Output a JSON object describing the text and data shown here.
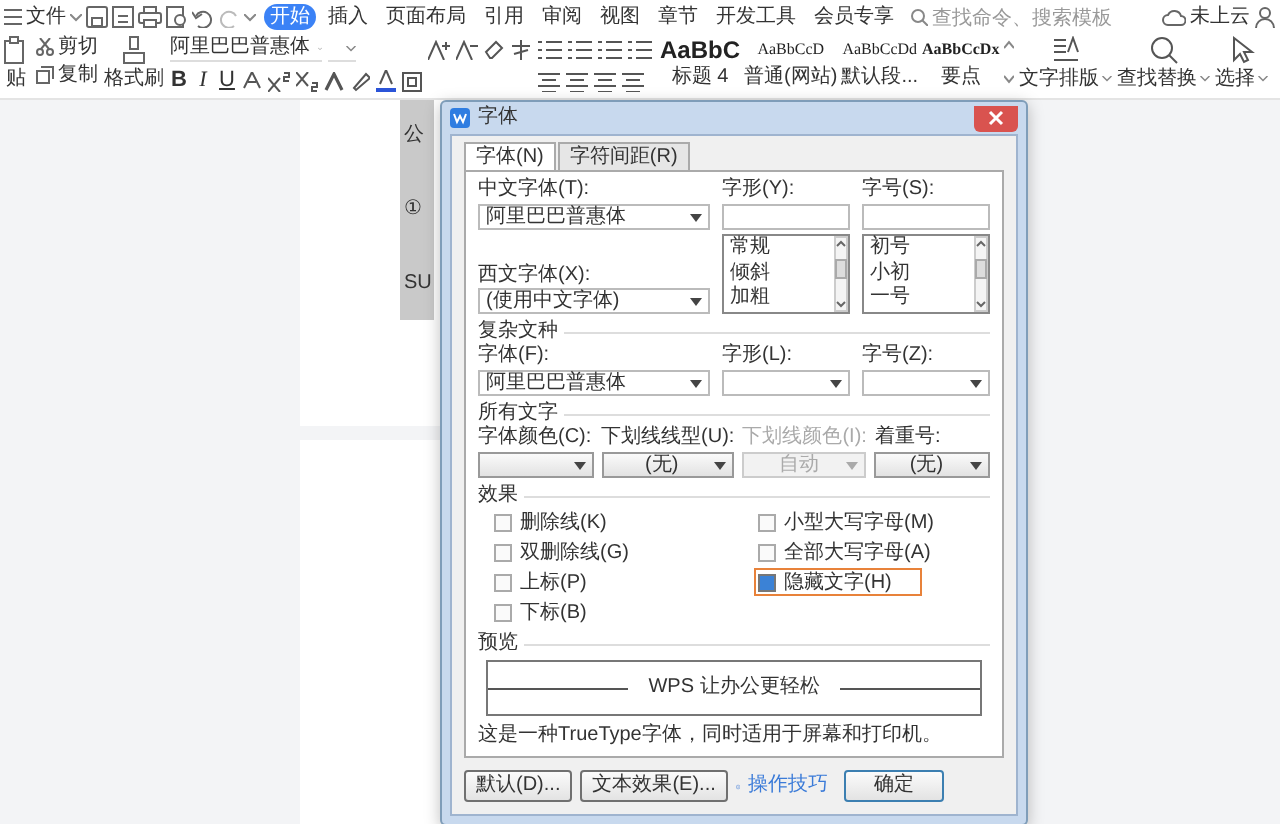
{
  "menu": {
    "file": "文件",
    "tabs": [
      {
        "label": "开始",
        "selected": true
      },
      {
        "label": "插入",
        "selected": false
      },
      {
        "label": "页面布局",
        "selected": false
      },
      {
        "label": "引用",
        "selected": false
      },
      {
        "label": "审阅",
        "selected": false
      },
      {
        "label": "视图",
        "selected": false
      },
      {
        "label": "章节",
        "selected": false
      },
      {
        "label": "开发工具",
        "selected": false
      },
      {
        "label": "会员专享",
        "selected": false
      }
    ],
    "search": {
      "placeholder": "查找命令、搜索模板"
    },
    "account": "未上云"
  },
  "ribbon": {
    "paste": "贴",
    "cut": "剪切",
    "copy": "复制",
    "format_painter": "格式刷",
    "font_name": "阿里巴巴普惠体",
    "text_buttons": [
      "B",
      "I",
      "U"
    ],
    "styles": [
      {
        "sample": "AaBbC",
        "label": "标题 4",
        "kind": "heading"
      },
      {
        "sample": "AaBbCcD",
        "label": "普通(网站)",
        "kind": "normal"
      },
      {
        "sample": "AaBbCcDd",
        "label": "默认段...",
        "kind": "normal"
      },
      {
        "sample": "AaBbCcDx",
        "label": "要点",
        "kind": "strong"
      }
    ],
    "tools": [
      {
        "label": "文字排版",
        "kind": "layout"
      },
      {
        "label": "查找替换",
        "kind": "find"
      },
      {
        "label": "选择",
        "kind": "select"
      }
    ]
  },
  "document": {
    "lines": [
      "公",
      "①",
      "SU"
    ]
  },
  "dialog": {
    "title": "字体",
    "tabs": [
      {
        "label": "字体(N)",
        "selected": true
      },
      {
        "label": "字符间距(R)",
        "selected": false
      }
    ],
    "chinese_font": {
      "label": "中文字体(T):",
      "value": "阿里巴巴普惠体"
    },
    "style": {
      "label": "字形(Y):",
      "options": [
        "常规",
        "倾斜",
        "加粗"
      ]
    },
    "size": {
      "label": "字号(S):",
      "options": [
        "初号",
        "小初",
        "一号"
      ]
    },
    "western_font": {
      "label": "西文字体(X):",
      "value": "(使用中文字体)"
    },
    "complex": {
      "title": "复杂文种",
      "fields": [
        {
          "label": "字体(F):",
          "value": "阿里巴巴普惠体"
        },
        {
          "label": "字形(L):"
        },
        {
          "label": "字号(Z):"
        }
      ]
    },
    "all_text": {
      "title": "所有文字",
      "fields": [
        {
          "label": "字体颜色(C):",
          "disabled": false
        },
        {
          "label": "下划线线型(U):",
          "value": "(无)",
          "disabled": false
        },
        {
          "label": "下划线颜色(I):",
          "value": "自动",
          "disabled": true
        },
        {
          "label": "着重号:",
          "value": "(无)",
          "disabled": false
        }
      ]
    },
    "effects": {
      "title": "效果",
      "columns": [
        [
          {
            "label": "删除线(K)",
            "checked": false,
            "highlighted": false
          },
          {
            "label": "双删除线(G)",
            "checked": false,
            "highlighted": false
          },
          {
            "label": "上标(P)",
            "checked": false,
            "highlighted": false
          },
          {
            "label": "下标(B)",
            "checked": false,
            "highlighted": false
          }
        ],
        [
          {
            "label": "小型大写字母(M)",
            "checked": false,
            "highlighted": false
          },
          {
            "label": "全部大写字母(A)",
            "checked": false,
            "highlighted": false
          },
          {
            "label": "隐藏文字(H)",
            "checked": true,
            "highlighted": true
          }
        ]
      ]
    },
    "preview": {
      "title": "预览",
      "text": "WPS 让办公更轻松"
    },
    "note": "这是一种TrueType字体，同时适用于屏幕和打印机。",
    "buttons": [
      {
        "label": "默认(D)...",
        "kind": "button"
      },
      {
        "label": "文本效果(E)...",
        "kind": "button"
      },
      {
        "label": "操作技巧",
        "kind": "link"
      },
      {
        "label": "确定",
        "kind": "primary"
      }
    ]
  }
}
